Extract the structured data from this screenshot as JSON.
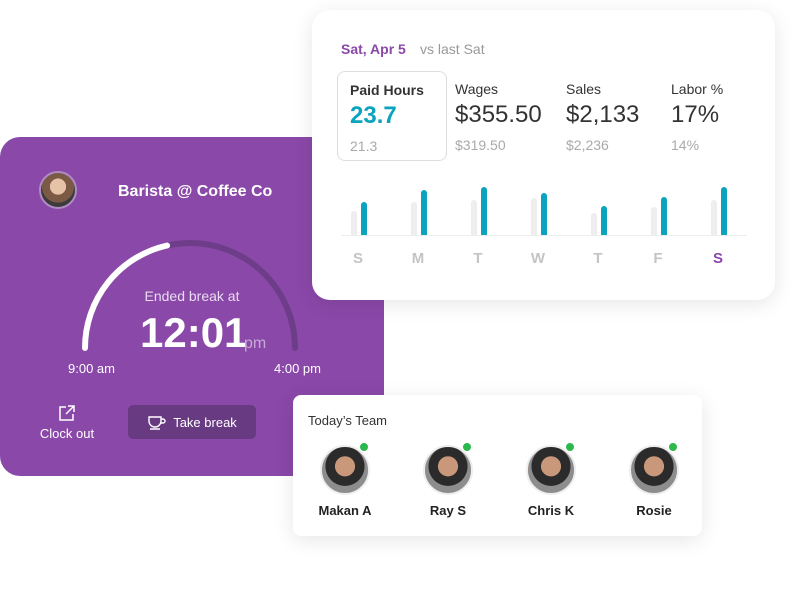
{
  "shift": {
    "title": "Barista @ Coffee Co",
    "status": "Ended break at",
    "time": "12:01",
    "meridiem": "pm",
    "start": "9:00 am",
    "end": "4:00 pm",
    "progress": 0.43,
    "clock_out": "Clock out",
    "take_break": "Take break",
    "colors": {
      "card": "#8a48a8",
      "button": "#683a82"
    }
  },
  "stats": {
    "date": "Sat, Apr 5",
    "compare": "vs last Sat",
    "metrics": [
      {
        "name": "Paid Hours",
        "value": "23.7",
        "previous": "21.3",
        "selected": true
      },
      {
        "name": "Wages",
        "value": "$355.50",
        "previous": "$319.50"
      },
      {
        "name": "Sales",
        "value": "$2,133",
        "previous": "$2,236"
      },
      {
        "name": "Labor %",
        "value": "17%",
        "previous": "14%"
      }
    ]
  },
  "chart_data": {
    "type": "bar",
    "categories": [
      "S",
      "M",
      "T",
      "W",
      "T",
      "F",
      "S"
    ],
    "highlight_index": 6,
    "series": [
      {
        "values": [
          24,
          33,
          35,
          37,
          22,
          28,
          35
        ],
        "color": "#eeeeee"
      },
      {
        "values": [
          33,
          45,
          48,
          42,
          29,
          38,
          48
        ],
        "color": "#0ba3bd"
      }
    ]
  },
  "team": {
    "title": "Today’s Team",
    "members": [
      {
        "name": "Makan A",
        "online": true
      },
      {
        "name": "Ray S",
        "online": true
      },
      {
        "name": "Chris K",
        "online": true
      },
      {
        "name": "Rosie",
        "online": true
      }
    ]
  }
}
